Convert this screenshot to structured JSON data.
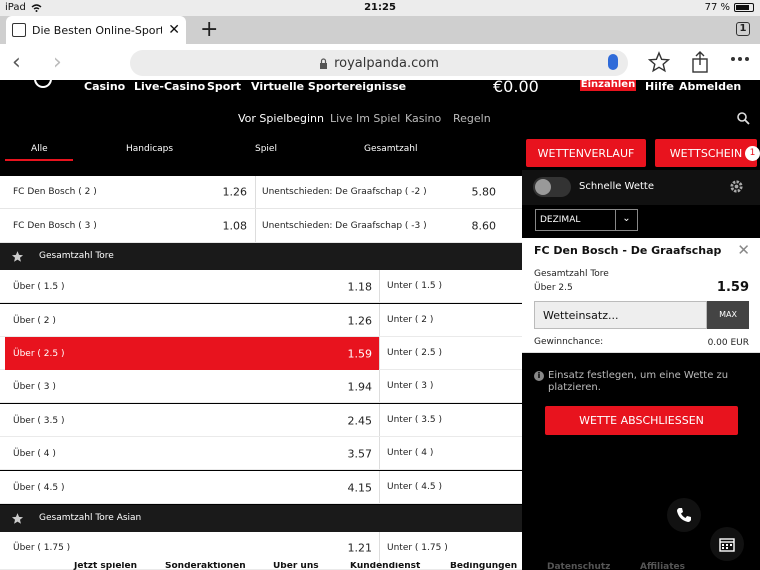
{
  "status": {
    "device": "iPad",
    "time": "21:25",
    "battery": "77 %"
  },
  "browser": {
    "tab_title": "Die Besten Online-Sportwetten",
    "tab_count": "1",
    "url": "royalpanda.com"
  },
  "topnav": {
    "items": [
      "Casino",
      "Live-Casino",
      "Sport",
      "Virtuelle Sportereignisse"
    ],
    "balance": "€0.00",
    "deposit": "Einzahlen",
    "help": "Hilfe",
    "logout": "Abmelden"
  },
  "subnav": [
    "Vor Spielbeginn",
    "Live Im Spiel",
    "Kasino",
    "Regeln"
  ],
  "filters": [
    "Alle",
    "Handicaps",
    "Spiel",
    "Gesamtzahl"
  ],
  "handicap_rows": [
    {
      "label": "FC Den Bosch ( 2 )",
      "odd": "1.26",
      "label2": "Unentschieden: De Graafschap ( -2 )",
      "odd2": "5.80"
    },
    {
      "label": "FC Den Bosch ( 3 )",
      "odd": "1.08",
      "label2": "Unentschieden: De Graafschap ( -3 )",
      "odd2": "8.60"
    }
  ],
  "section_total": "Gesamtzahl Tore",
  "totals": [
    {
      "over": "Über ( 1.5 )",
      "odd": "1.18",
      "under": "Unter ( 1.5 )"
    },
    {
      "over": "Über ( 2 )",
      "odd": "1.26",
      "under": "Unter ( 2 )"
    },
    {
      "over": "Über ( 2.5 )",
      "odd": "1.59",
      "under": "Unter ( 2.5 )",
      "selected": true
    },
    {
      "over": "Über ( 3 )",
      "odd": "1.94",
      "under": "Unter ( 3 )"
    },
    {
      "over": "Über ( 3.5 )",
      "odd": "2.45",
      "under": "Unter ( 3.5 )"
    },
    {
      "over": "Über ( 4 )",
      "odd": "3.57",
      "under": "Unter ( 4 )"
    },
    {
      "over": "Über ( 4.5 )",
      "odd": "4.15",
      "under": "Unter ( 4.5 )"
    }
  ],
  "section_asian": "Gesamtzahl Tore Asian",
  "asian_row": {
    "over": "Über ( 1.75 )",
    "odd": "1.21",
    "under": "Unter ( 1.75 )"
  },
  "footer": [
    "Jetzt spielen",
    "Sonderaktionen",
    "Über uns",
    "Kundendienst",
    "Bedingungen"
  ],
  "betslip": {
    "history_btn": "WETTENVERLAUF",
    "slip_btn": "WETTSCHEIN",
    "slip_count": "1",
    "quick_bet": "Schnelle Wette",
    "odds_format": "DEZIMAL",
    "match": "FC Den Bosch - De Graafschap",
    "market": "Gesamtzahl Tore",
    "selection": "Über 2.5",
    "odd": "1.59",
    "stake_placeholder": "Wetteinsatz...",
    "max": "MAX",
    "win_label": "Gewinnchance:",
    "win_value": "0.00 EUR",
    "info": "Einsatz festlegen, um eine Wette zu platzieren.",
    "place_btn": "WETTE ABSCHLIESSEN"
  },
  "side_footer": [
    "Datenschutz",
    "Affiliates"
  ],
  "colors": {
    "accent": "#e8131e"
  }
}
